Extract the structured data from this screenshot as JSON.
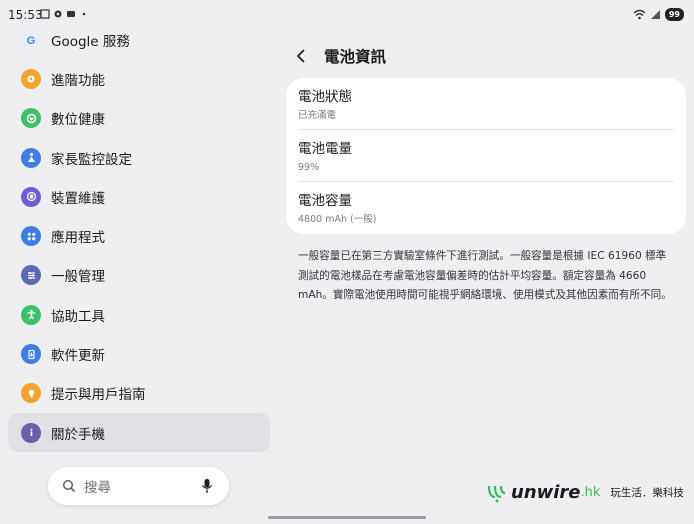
{
  "status_bar": {
    "time": "15:53",
    "battery": "99"
  },
  "sidebar": {
    "items": [
      {
        "label": "Google 服務",
        "icon": "google-icon",
        "color": "#4a82f0"
      },
      {
        "label": "進階功能",
        "icon": "star-gear-icon",
        "color": "#f3a42c"
      },
      {
        "label": "數位健康",
        "icon": "heart-icon",
        "color": "#3fbf6a"
      },
      {
        "label": "家長監控設定",
        "icon": "child-icon",
        "color": "#3d7de4"
      },
      {
        "label": "裝置維護",
        "icon": "device-care-icon",
        "color": "#6b5fd3"
      },
      {
        "label": "應用程式",
        "icon": "apps-icon",
        "color": "#3d7de4"
      },
      {
        "label": "一般管理",
        "icon": "sliders-icon",
        "color": "#5b6bb3"
      },
      {
        "label": "協助工具",
        "icon": "accessibility-icon",
        "color": "#3fbf6a"
      },
      {
        "label": "軟件更新",
        "icon": "update-icon",
        "color": "#3d7de4"
      },
      {
        "label": "提示與用戶指南",
        "icon": "bulb-icon",
        "color": "#f3a42c"
      },
      {
        "label": "關於手機",
        "icon": "info-icon",
        "color": "#6b5fa8",
        "active": true
      }
    ]
  },
  "search": {
    "placeholder": "搜尋"
  },
  "page": {
    "title": "電池資訊",
    "rows": [
      {
        "title": "電池狀態",
        "sub": "已充滿電"
      },
      {
        "title": "電池電量",
        "sub": "99%"
      },
      {
        "title": "電池容量",
        "sub": "4800 mAh (一般)"
      }
    ],
    "note": "一般容量已在第三方實驗室條件下進行測試。一般容量是根據 IEC 61960 標準測試的電池樣品在考慮電池容量偏差時的估計平均容量。額定容量為 4660 mAh。實際電池使用時間可能視乎網絡環境、使用模式及其他因素而有所不同。"
  },
  "watermark": {
    "logo": "unwire",
    "suffix": ".hk",
    "slogan": "玩生活．樂科技"
  }
}
